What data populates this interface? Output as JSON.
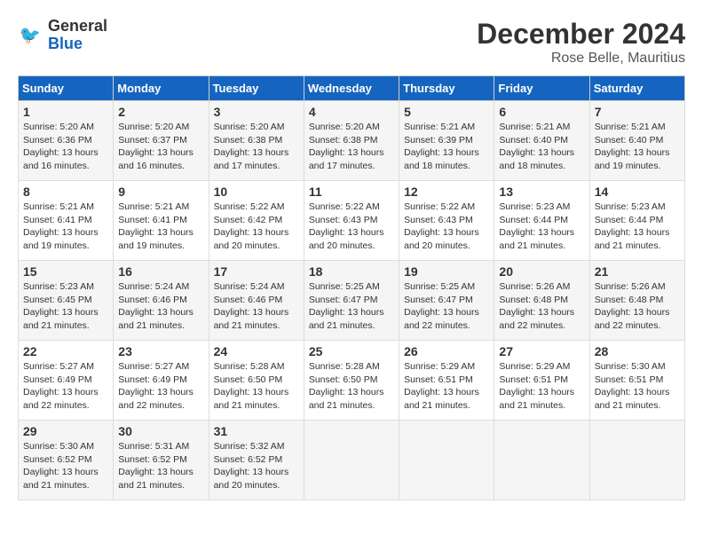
{
  "header": {
    "logo_line1": "General",
    "logo_line2": "Blue",
    "main_title": "December 2024",
    "subtitle": "Rose Belle, Mauritius"
  },
  "calendar": {
    "days_of_week": [
      "Sunday",
      "Monday",
      "Tuesday",
      "Wednesday",
      "Thursday",
      "Friday",
      "Saturday"
    ],
    "weeks": [
      [
        {
          "day": "1",
          "sunrise": "5:20 AM",
          "sunset": "6:36 PM",
          "daylight": "13 hours and 16 minutes."
        },
        {
          "day": "2",
          "sunrise": "5:20 AM",
          "sunset": "6:37 PM",
          "daylight": "13 hours and 16 minutes."
        },
        {
          "day": "3",
          "sunrise": "5:20 AM",
          "sunset": "6:38 PM",
          "daylight": "13 hours and 17 minutes."
        },
        {
          "day": "4",
          "sunrise": "5:20 AM",
          "sunset": "6:38 PM",
          "daylight": "13 hours and 17 minutes."
        },
        {
          "day": "5",
          "sunrise": "5:21 AM",
          "sunset": "6:39 PM",
          "daylight": "13 hours and 18 minutes."
        },
        {
          "day": "6",
          "sunrise": "5:21 AM",
          "sunset": "6:40 PM",
          "daylight": "13 hours and 18 minutes."
        },
        {
          "day": "7",
          "sunrise": "5:21 AM",
          "sunset": "6:40 PM",
          "daylight": "13 hours and 19 minutes."
        }
      ],
      [
        {
          "day": "8",
          "sunrise": "5:21 AM",
          "sunset": "6:41 PM",
          "daylight": "13 hours and 19 minutes."
        },
        {
          "day": "9",
          "sunrise": "5:21 AM",
          "sunset": "6:41 PM",
          "daylight": "13 hours and 19 minutes."
        },
        {
          "day": "10",
          "sunrise": "5:22 AM",
          "sunset": "6:42 PM",
          "daylight": "13 hours and 20 minutes."
        },
        {
          "day": "11",
          "sunrise": "5:22 AM",
          "sunset": "6:43 PM",
          "daylight": "13 hours and 20 minutes."
        },
        {
          "day": "12",
          "sunrise": "5:22 AM",
          "sunset": "6:43 PM",
          "daylight": "13 hours and 20 minutes."
        },
        {
          "day": "13",
          "sunrise": "5:23 AM",
          "sunset": "6:44 PM",
          "daylight": "13 hours and 21 minutes."
        },
        {
          "day": "14",
          "sunrise": "5:23 AM",
          "sunset": "6:44 PM",
          "daylight": "13 hours and 21 minutes."
        }
      ],
      [
        {
          "day": "15",
          "sunrise": "5:23 AM",
          "sunset": "6:45 PM",
          "daylight": "13 hours and 21 minutes."
        },
        {
          "day": "16",
          "sunrise": "5:24 AM",
          "sunset": "6:46 PM",
          "daylight": "13 hours and 21 minutes."
        },
        {
          "day": "17",
          "sunrise": "5:24 AM",
          "sunset": "6:46 PM",
          "daylight": "13 hours and 21 minutes."
        },
        {
          "day": "18",
          "sunrise": "5:25 AM",
          "sunset": "6:47 PM",
          "daylight": "13 hours and 21 minutes."
        },
        {
          "day": "19",
          "sunrise": "5:25 AM",
          "sunset": "6:47 PM",
          "daylight": "13 hours and 22 minutes."
        },
        {
          "day": "20",
          "sunrise": "5:26 AM",
          "sunset": "6:48 PM",
          "daylight": "13 hours and 22 minutes."
        },
        {
          "day": "21",
          "sunrise": "5:26 AM",
          "sunset": "6:48 PM",
          "daylight": "13 hours and 22 minutes."
        }
      ],
      [
        {
          "day": "22",
          "sunrise": "5:27 AM",
          "sunset": "6:49 PM",
          "daylight": "13 hours and 22 minutes."
        },
        {
          "day": "23",
          "sunrise": "5:27 AM",
          "sunset": "6:49 PM",
          "daylight": "13 hours and 22 minutes."
        },
        {
          "day": "24",
          "sunrise": "5:28 AM",
          "sunset": "6:50 PM",
          "daylight": "13 hours and 21 minutes."
        },
        {
          "day": "25",
          "sunrise": "5:28 AM",
          "sunset": "6:50 PM",
          "daylight": "13 hours and 21 minutes."
        },
        {
          "day": "26",
          "sunrise": "5:29 AM",
          "sunset": "6:51 PM",
          "daylight": "13 hours and 21 minutes."
        },
        {
          "day": "27",
          "sunrise": "5:29 AM",
          "sunset": "6:51 PM",
          "daylight": "13 hours and 21 minutes."
        },
        {
          "day": "28",
          "sunrise": "5:30 AM",
          "sunset": "6:51 PM",
          "daylight": "13 hours and 21 minutes."
        }
      ],
      [
        {
          "day": "29",
          "sunrise": "5:30 AM",
          "sunset": "6:52 PM",
          "daylight": "13 hours and 21 minutes."
        },
        {
          "day": "30",
          "sunrise": "5:31 AM",
          "sunset": "6:52 PM",
          "daylight": "13 hours and 21 minutes."
        },
        {
          "day": "31",
          "sunrise": "5:32 AM",
          "sunset": "6:52 PM",
          "daylight": "13 hours and 20 minutes."
        },
        null,
        null,
        null,
        null
      ]
    ]
  },
  "labels": {
    "sunrise": "Sunrise:",
    "sunset": "Sunset:",
    "daylight": "Daylight:"
  }
}
